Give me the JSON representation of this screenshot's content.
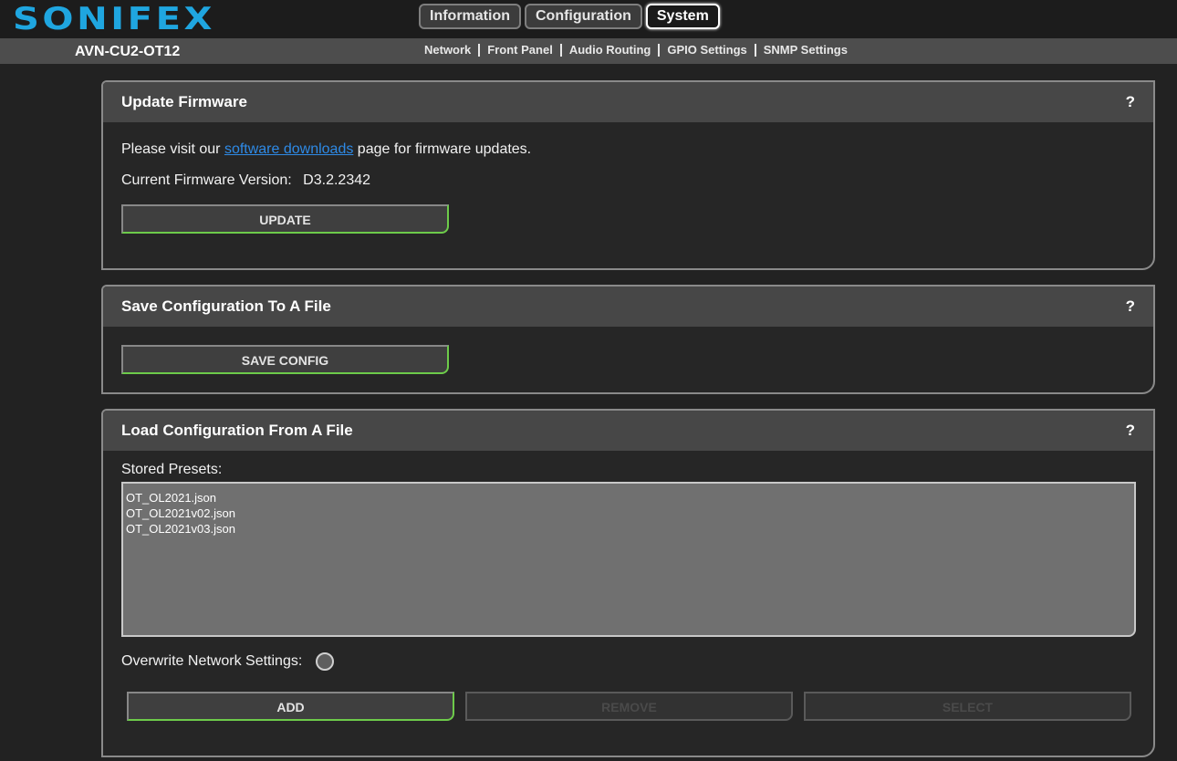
{
  "header": {
    "logo": "SONIFEX",
    "tabs": [
      {
        "label": "Information"
      },
      {
        "label": "Configuration"
      },
      {
        "label": "System"
      }
    ]
  },
  "subbar": {
    "device_name": "AVN-CU2-OT12",
    "links": [
      "Network",
      "Front Panel",
      "Audio Routing",
      "GPIO Settings",
      "SNMP Settings"
    ]
  },
  "update_firmware": {
    "title": "Update Firmware",
    "help": "?",
    "text_before": "Please visit our ",
    "link_text": "software downloads",
    "text_after": " page for firmware updates.",
    "version_label": "Current Firmware Version:",
    "version_value": "D3.2.2342",
    "button": "UPDATE"
  },
  "save_config": {
    "title": "Save Configuration To A File",
    "help": "?",
    "button": "SAVE CONFIG"
  },
  "load_config": {
    "title": "Load Configuration From A File",
    "help": "?",
    "presets_label": "Stored Presets:",
    "presets": [
      "OT_OL2021.json",
      "OT_OL2021v02.json",
      "OT_OL2021v03.json"
    ],
    "overwrite_label": "Overwrite Network Settings:",
    "buttons": {
      "add": "ADD",
      "remove": "REMOVE",
      "select": "SELECT"
    }
  }
}
